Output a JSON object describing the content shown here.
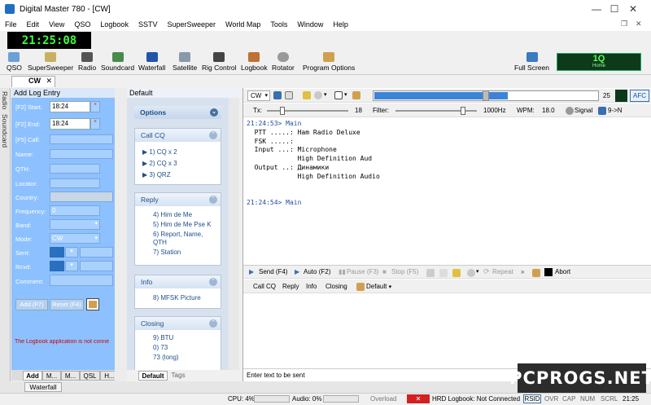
{
  "window": {
    "title": "Digital Master 780 - [CW]",
    "minimize": "—",
    "maximize": "☐",
    "close": "✕",
    "mdi_restore": "❐",
    "mdi_close": "✕"
  },
  "menu": [
    "File",
    "Edit",
    "View",
    "QSO",
    "Logbook",
    "SSTV",
    "SuperSweeper",
    "World Map",
    "Tools",
    "Window",
    "Help"
  ],
  "clock": "21:25:08",
  "toolbar": [
    "QSO",
    "SuperSweeper",
    "Radio",
    "Soundcard",
    "Waterfall",
    "Satellite",
    "Rig Control",
    "Logbook",
    "Rotator",
    "Program Options"
  ],
  "full_screen": "Full Screen",
  "q_indicator": {
    "value": "1Q",
    "label": "Home"
  },
  "active_tab": "CW",
  "side_tabs": [
    "Radio",
    "Soundcard"
  ],
  "log_entry": {
    "title": "Add Log Entry",
    "fields": [
      {
        "label": "[F2] Start:",
        "value": "18:24"
      },
      {
        "label": "[F2] End:",
        "value": "18:24"
      },
      {
        "label": "[F5] Call:",
        "value": ""
      },
      {
        "label": "Name:",
        "value": ""
      },
      {
        "label": "QTH:",
        "value": ""
      },
      {
        "label": "Locator:",
        "value": ""
      },
      {
        "label": "Country:",
        "value": ""
      },
      {
        "label": "Frequency:",
        "value": "0"
      },
      {
        "label": "Band:",
        "value": ""
      },
      {
        "label": "Mode:",
        "value": "CW"
      },
      {
        "label": "Sent:",
        "value": ""
      },
      {
        "label": "Rcvd:",
        "value": ""
      },
      {
        "label": "Comment:",
        "value": ""
      }
    ],
    "add_button": "Add (F7)",
    "reset_button": "Reset (F4)",
    "error": "The Logbook application is not conne"
  },
  "bottom_tabs": [
    "Add",
    "M...",
    "M...",
    "QSL",
    "H..."
  ],
  "waterfall_tab": "Waterfall",
  "macros": {
    "title": "Default",
    "options_label": "Options",
    "sections": [
      {
        "title": "Call CQ",
        "items": [
          "1) CQ x 2",
          "2) CQ x 3",
          "3) QRZ"
        ]
      },
      {
        "title": "Reply",
        "items": [
          "4) Him de Me",
          "5) Him de Me Pse K",
          "6) Report, Name, QTH",
          "7) Station"
        ]
      },
      {
        "title": "Info",
        "items": [
          "8) MFSK Picture"
        ]
      },
      {
        "title": "Closing",
        "items": [
          "9) BTU",
          "0) 73",
          "73 (long)"
        ]
      }
    ],
    "tabs": [
      "Default",
      "Tags"
    ]
  },
  "cw_toolbar": {
    "mode": "CW",
    "level": "25",
    "afc": "AFC",
    "progress": 0.6
  },
  "tx_row": {
    "tx_label": "Tx:",
    "tx_value": "18",
    "filter_label": "Filter:",
    "filter_value": "1000Hz",
    "wpm_label": "WPM:",
    "wpm_value": "18.0",
    "signal": "Signal",
    "route": "9->N"
  },
  "monitor": [
    {
      "ts": "21:24:53> ",
      "txt": "Main"
    },
    {
      "ts": "",
      "txt": "  PTT .....: Ham Radio Deluxe"
    },
    {
      "ts": "",
      "txt": "  FSK .....:"
    },
    {
      "ts": "",
      "txt": "  Input ...: Microphone"
    },
    {
      "ts": "",
      "txt": "             High Definition Aud"
    },
    {
      "ts": "",
      "txt": "  Output ..: Динамики"
    },
    {
      "ts": "",
      "txt": "             High Definition Audio"
    },
    {
      "ts": "",
      "txt": ""
    },
    {
      "ts": "",
      "txt": ""
    },
    {
      "ts": "21:24:54> ",
      "txt": "Main"
    }
  ],
  "tx_toolbar": {
    "send": "Send",
    "send_key": "(F4)",
    "auto": "Auto",
    "auto_key": "(F2)",
    "pause": "Pause",
    "pause_key": "(F3)",
    "stop": "Stop",
    "stop_key": "(F5)",
    "repeat": "Repeat",
    "abort": "Abort"
  },
  "macro_bar": [
    "Call CQ",
    "Reply",
    "Info",
    "Closing",
    "Default"
  ],
  "tx_hint": "Enter text to be sent",
  "tx_col": "8",
  "status": {
    "cpu": "CPU: 4%",
    "audio": "Audio: 0%",
    "overload": "Overload",
    "hrd": "HRD Logbook: Not Connected",
    "rsid": "RSID",
    "ovr": "OVR",
    "cap": "CAP",
    "num": "NUM",
    "scrl": "SCRL",
    "time": "21:25"
  },
  "watermark": "PCPROGS.NET"
}
